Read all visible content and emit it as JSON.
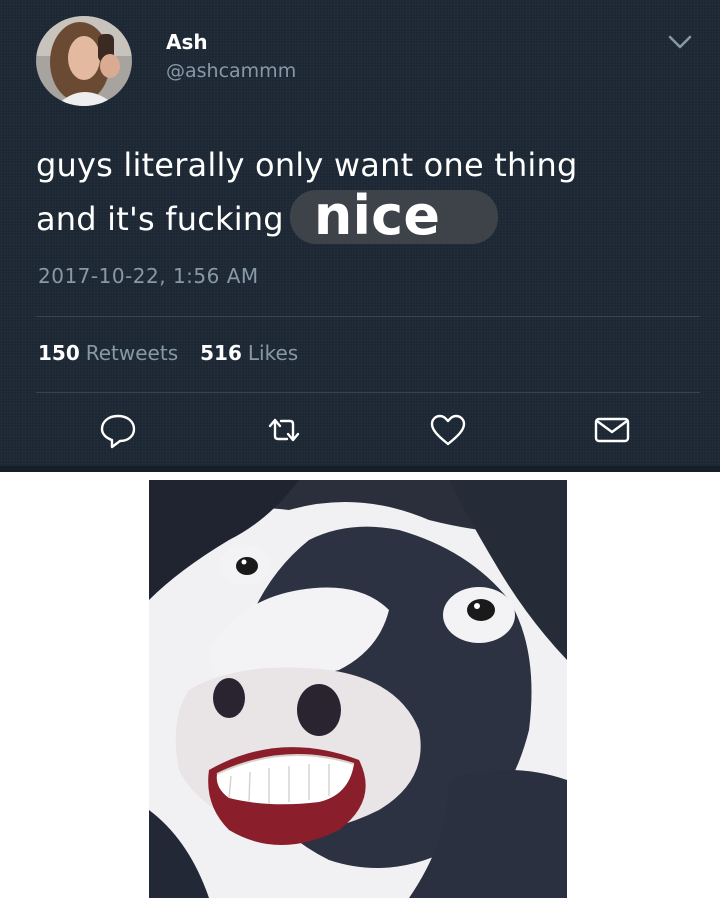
{
  "tweet": {
    "display_name": "Ash",
    "handle": "@ashcammm",
    "text_line1": "guys literally only want one thing",
    "text_line2": "and it's fucking",
    "highlight_word": "nice",
    "timestamp": "2017-10-22, 1:56 AM",
    "stats": {
      "retweets_count": "150",
      "retweets_label": "Retweets",
      "likes_count": "516",
      "likes_label": "Likes"
    },
    "actions": [
      "reply-icon",
      "retweet-icon",
      "like-icon",
      "message-icon"
    ]
  },
  "colors": {
    "background": "#1b2733",
    "secondary_text": "#8899a6",
    "highlight_bg": "#3d4349"
  }
}
